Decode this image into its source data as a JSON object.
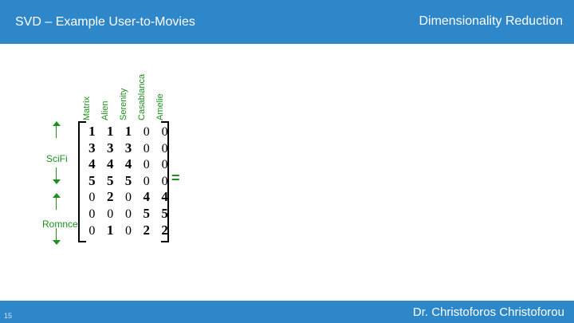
{
  "header": {
    "title": "SVD – Example User-to-Movies",
    "section": "Dimensionality Reduction"
  },
  "movies": [
    "Matrix",
    "Alien",
    "Serenity",
    "Casablanca",
    "Amelie"
  ],
  "groups": {
    "scifi": "SciFi",
    "romance": "Romnce"
  },
  "matrix": {
    "rows": [
      [
        "1",
        "1",
        "1",
        "0",
        "0"
      ],
      [
        "3",
        "3",
        "3",
        "0",
        "0"
      ],
      [
        "4",
        "4",
        "4",
        "0",
        "0"
      ],
      [
        "5",
        "5",
        "5",
        "0",
        "0"
      ],
      [
        "0",
        "2",
        "0",
        "4",
        "4"
      ],
      [
        "0",
        "0",
        "0",
        "5",
        "5"
      ],
      [
        "0",
        "1",
        "0",
        "2",
        "2"
      ]
    ],
    "bold": [
      [
        true,
        true,
        true,
        false,
        false
      ],
      [
        true,
        true,
        true,
        false,
        false
      ],
      [
        true,
        true,
        true,
        false,
        false
      ],
      [
        true,
        true,
        true,
        false,
        false
      ],
      [
        false,
        true,
        false,
        true,
        true
      ],
      [
        false,
        false,
        false,
        true,
        true
      ],
      [
        false,
        true,
        false,
        true,
        true
      ]
    ]
  },
  "equals_sign": "=",
  "footer": {
    "page_number": "15",
    "author": "Dr. Christoforos Christoforou"
  },
  "colors": {
    "band": "#2e87c9",
    "label_green": "#1d8f1d"
  }
}
